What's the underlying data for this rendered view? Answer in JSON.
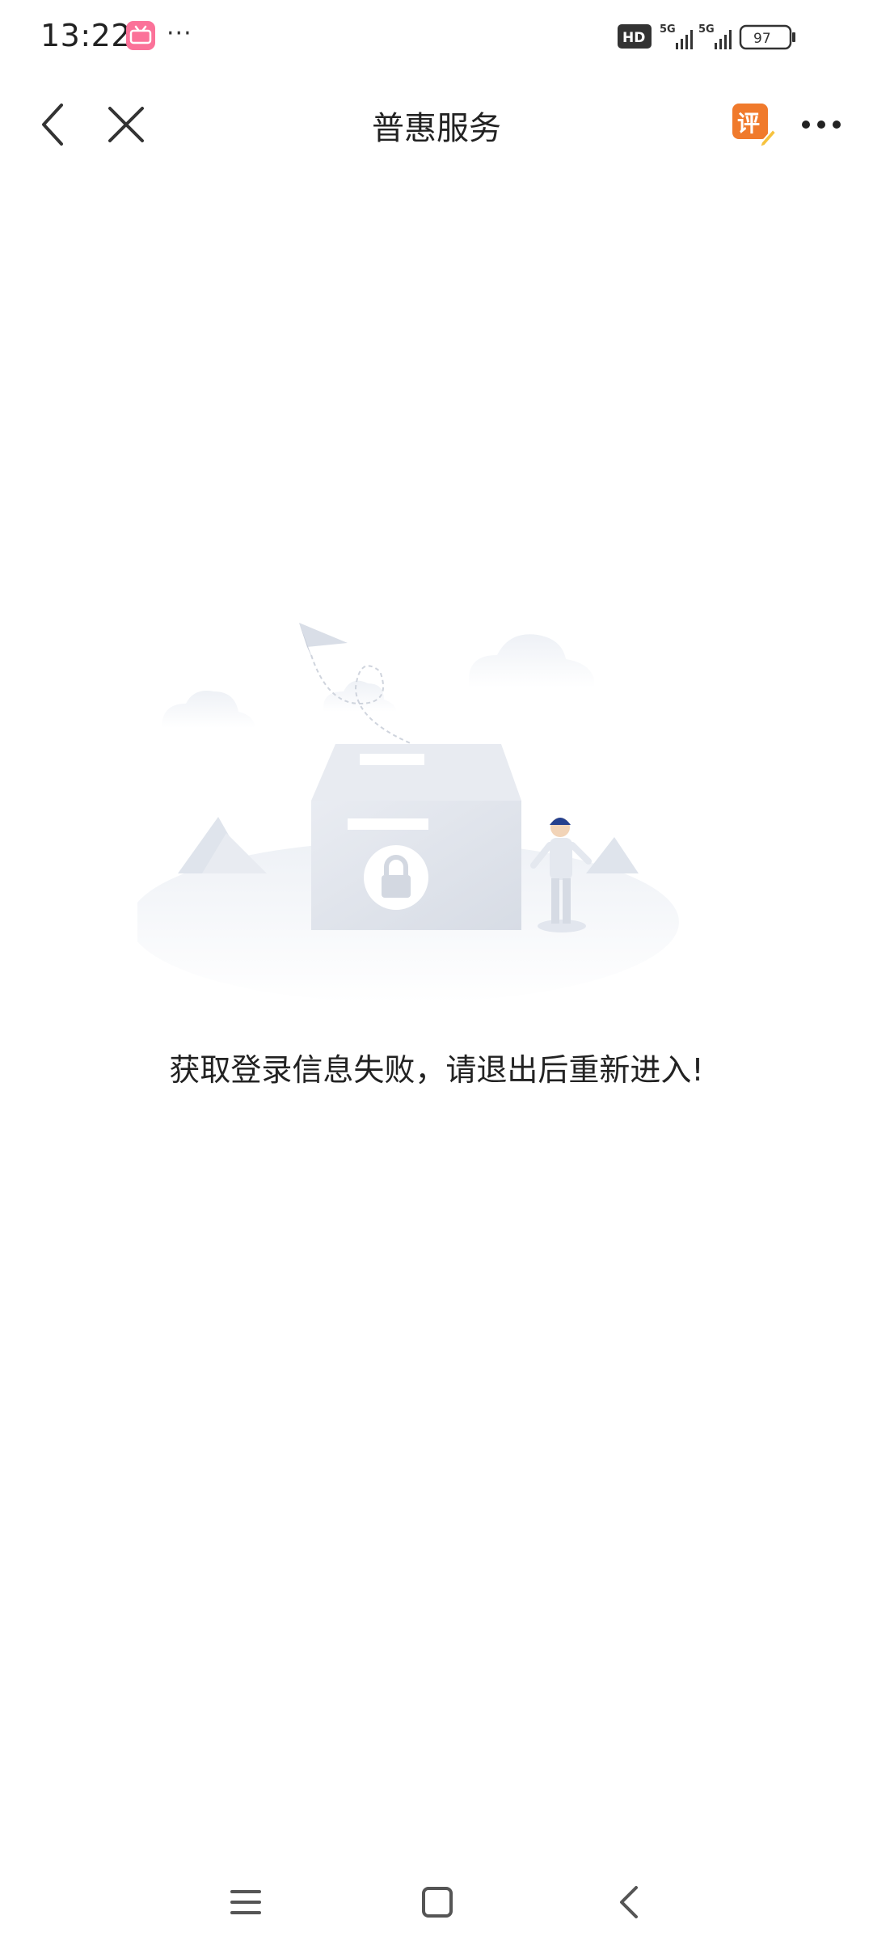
{
  "status_bar": {
    "time": "13:22",
    "more": "···",
    "battery": "97",
    "network": "5G",
    "hd_label": "HD"
  },
  "nav": {
    "title": "普惠服务",
    "review_label": "评"
  },
  "main": {
    "error_message": "获取登录信息失败，请退出后重新进入!"
  },
  "colors": {
    "review_badge": "#f07a2c",
    "bilibili": "#fb7299",
    "text": "#222222"
  },
  "icons": {
    "back": "chevron-left-icon",
    "close": "close-icon",
    "review": "review-icon",
    "more": "more-horizontal-icon",
    "home": "home-icon",
    "menu": "menu-icon"
  }
}
